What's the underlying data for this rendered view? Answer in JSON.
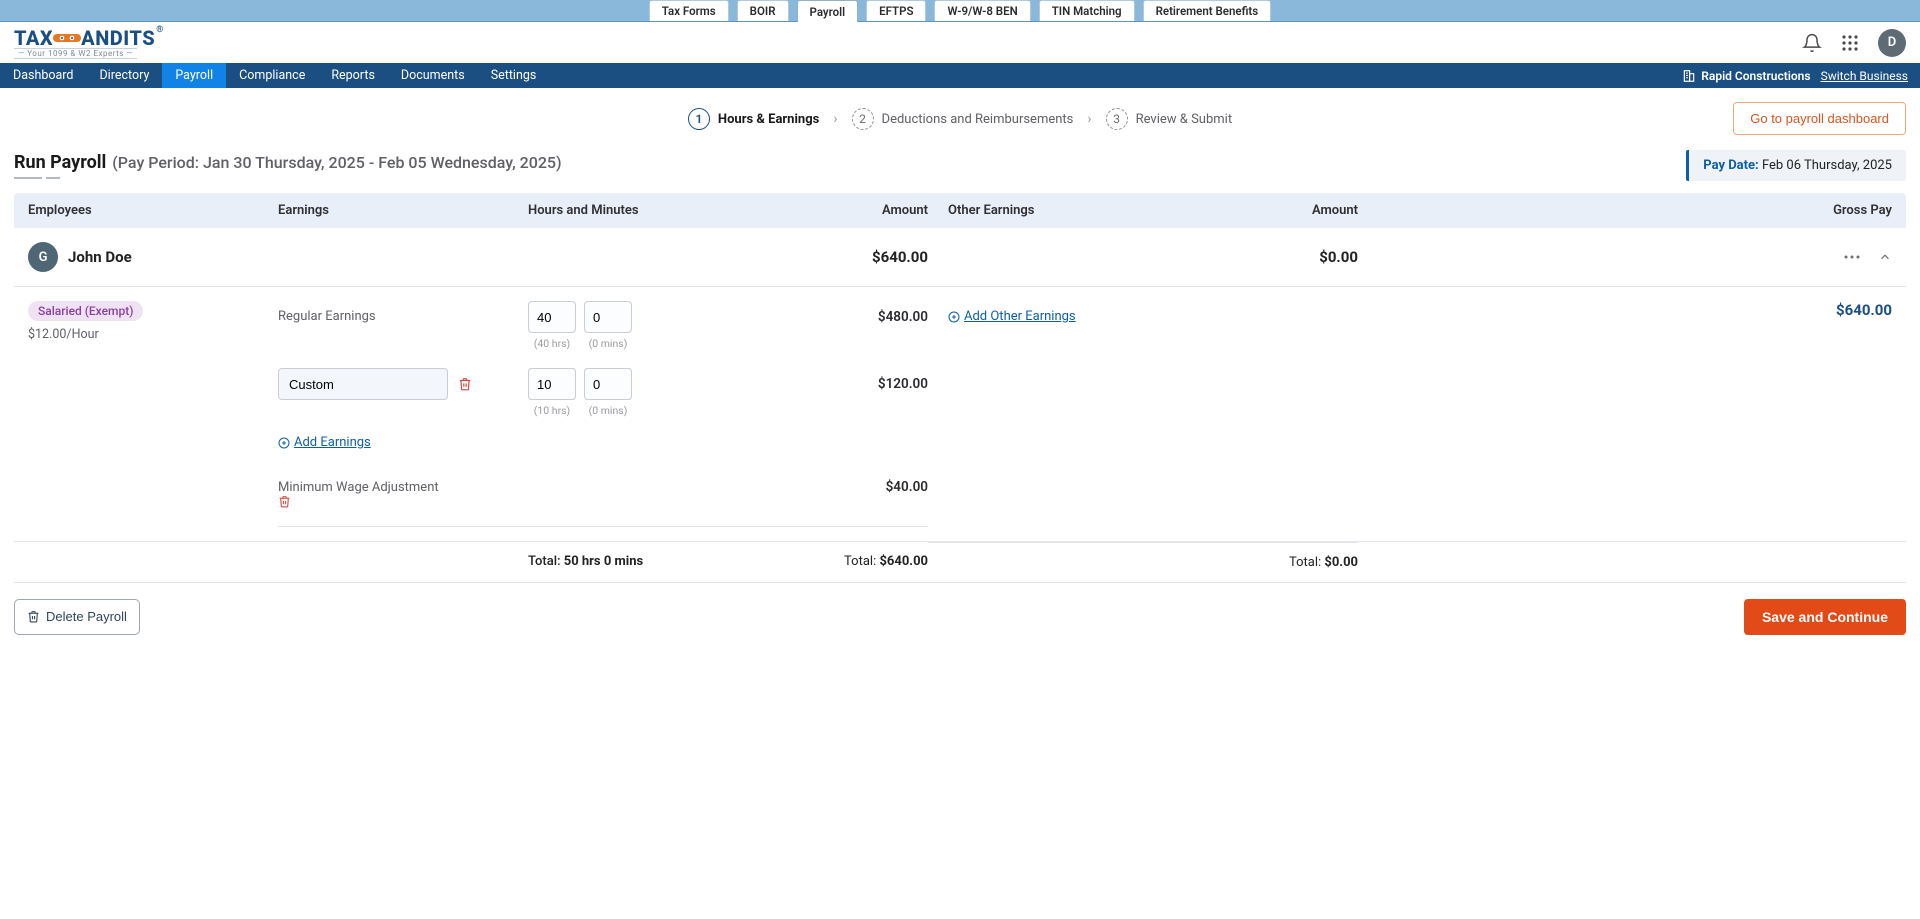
{
  "topTabs": {
    "items": [
      "Tax Forms",
      "BOIR",
      "Payroll",
      "EFTPS",
      "W-9/W-8 BEN",
      "TIN Matching",
      "Retirement Benefits"
    ],
    "activeIndex": 2
  },
  "logo": {
    "text": "TAXBANDITS",
    "sub": "— Your 1099 & W2 Experts —",
    "tm": "®"
  },
  "header": {
    "avatarInitial": "D"
  },
  "nav": {
    "items": [
      "Dashboard",
      "Directory",
      "Payroll",
      "Compliance",
      "Reports",
      "Documents",
      "Settings"
    ],
    "activeIndex": 2,
    "business": "Rapid Constructions",
    "switch": "Switch Business"
  },
  "steps": {
    "items": [
      {
        "num": "1",
        "label": "Hours & Earnings"
      },
      {
        "num": "2",
        "label": "Deductions and Reimbursements"
      },
      {
        "num": "3",
        "label": "Review & Submit"
      }
    ],
    "activeIndex": 0,
    "gotoButton": "Go to payroll dashboard"
  },
  "pageTitle": {
    "main": "Run Payroll",
    "paren": "(Pay Period: Jan 30 Thursday, 2025 - Feb 05 Wednesday, 2025)",
    "payDateLabel": "Pay Date:",
    "payDateValue": "Feb 06 Thursday, 2025"
  },
  "columns": {
    "employees": "Employees",
    "earnings": "Earnings",
    "hours": "Hours and Minutes",
    "amount": "Amount",
    "other": "Other Earnings",
    "amount2": "Amount",
    "gross": "Gross Pay"
  },
  "employee": {
    "avatar": "G",
    "name": "John Doe",
    "amount": "$640.00",
    "otherAmount": "$0.00",
    "classification": "Salaried (Exempt)",
    "rate": "$12.00/Hour",
    "gross": "$640.00",
    "regular": {
      "label": "Regular Earnings",
      "hours": "40",
      "mins": "0",
      "hoursHint": "(40 hrs)",
      "minsHint": "(0 mins)",
      "amount": "$480.00"
    },
    "custom": {
      "value": "Custom",
      "hours": "10",
      "mins": "0",
      "hoursHint": "(10 hrs)",
      "minsHint": "(0 mins)",
      "amount": "$120.00"
    },
    "addEarnings": "Add Earnings",
    "addOtherEarnings": "Add Other Earnings",
    "mwa": {
      "label": "Minimum Wage Adjustment",
      "amount": "$40.00"
    },
    "totals": {
      "timeLabel": "Total:",
      "time": "50 hrs 0 mins",
      "amountLabel": "Total:",
      "amount": "$640.00",
      "otherLabel": "Total:",
      "other": "$0.00"
    }
  },
  "footer": {
    "delete": "Delete Payroll",
    "save": "Save and Continue"
  }
}
